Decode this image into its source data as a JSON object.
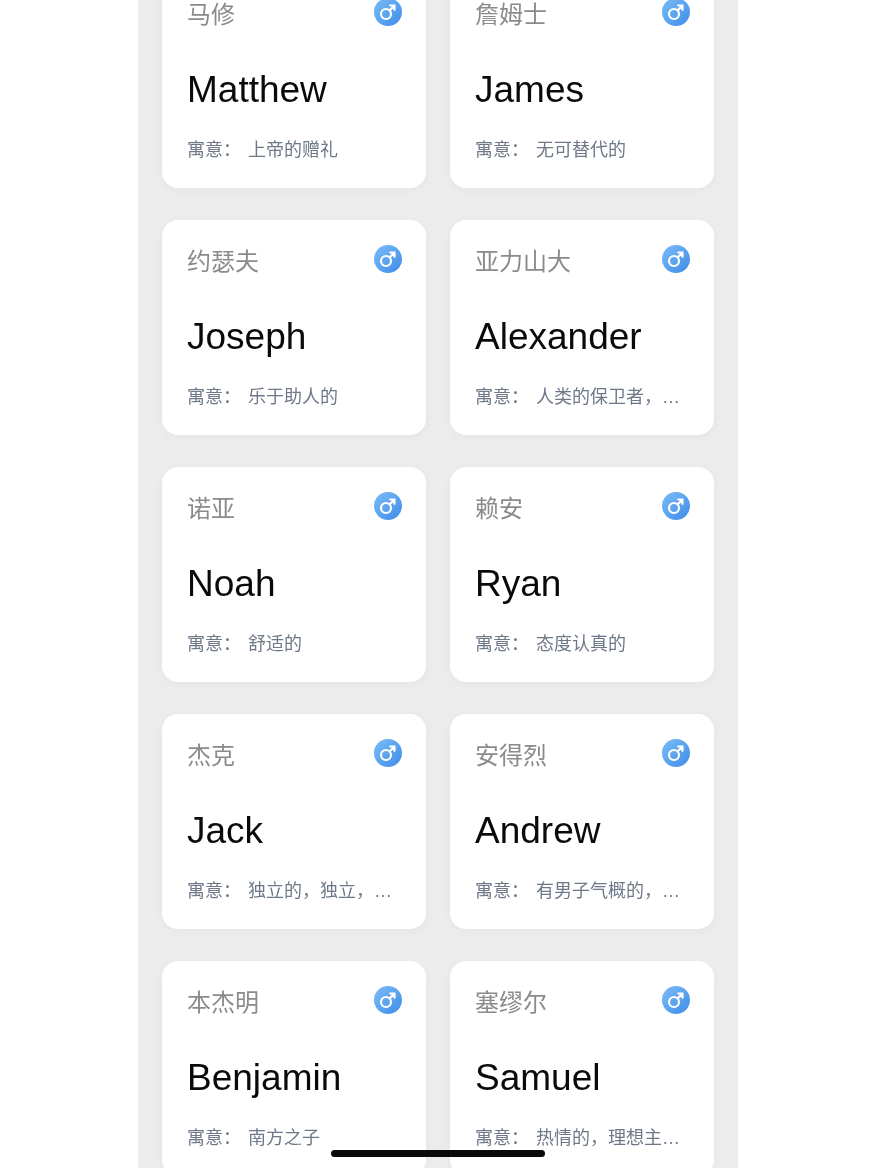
{
  "cards": [
    {
      "chinese_name": "马修",
      "english_name": "Matthew",
      "meaning_label": "寓意：",
      "meaning": "上帝的赠礼",
      "kind": "male"
    },
    {
      "chinese_name": "詹姆士",
      "english_name": "James",
      "meaning_label": "寓意：",
      "meaning": "无可替代的",
      "kind": "male"
    },
    {
      "chinese_name": "约瑟夫",
      "english_name": "Joseph",
      "meaning_label": "寓意：",
      "meaning": "乐于助人的",
      "kind": "male"
    },
    {
      "chinese_name": "亚力山大",
      "english_name": "Alexander",
      "meaning_label": "寓意：",
      "meaning": "人类的保卫者，…",
      "kind": "male"
    },
    {
      "chinese_name": "诺亚",
      "english_name": "Noah",
      "meaning_label": "寓意：",
      "meaning": "舒适的",
      "kind": "male"
    },
    {
      "chinese_name": "赖安",
      "english_name": "Ryan",
      "meaning_label": "寓意：",
      "meaning": "态度认真的",
      "kind": "male"
    },
    {
      "chinese_name": "杰克",
      "english_name": "Jack",
      "meaning_label": "寓意：",
      "meaning": "独立的，独立，…",
      "kind": "male"
    },
    {
      "chinese_name": "安得烈",
      "english_name": "Andrew",
      "meaning_label": "寓意：",
      "meaning": "有男子气概的，…",
      "kind": "male"
    },
    {
      "chinese_name": "本杰明",
      "english_name": "Benjamin",
      "meaning_label": "寓意：",
      "meaning": "南方之子",
      "kind": "male"
    },
    {
      "chinese_name": "塞缪尔",
      "english_name": "Samuel",
      "meaning_label": "寓意：",
      "meaning": "热情的，理想主…",
      "kind": "male"
    }
  ]
}
